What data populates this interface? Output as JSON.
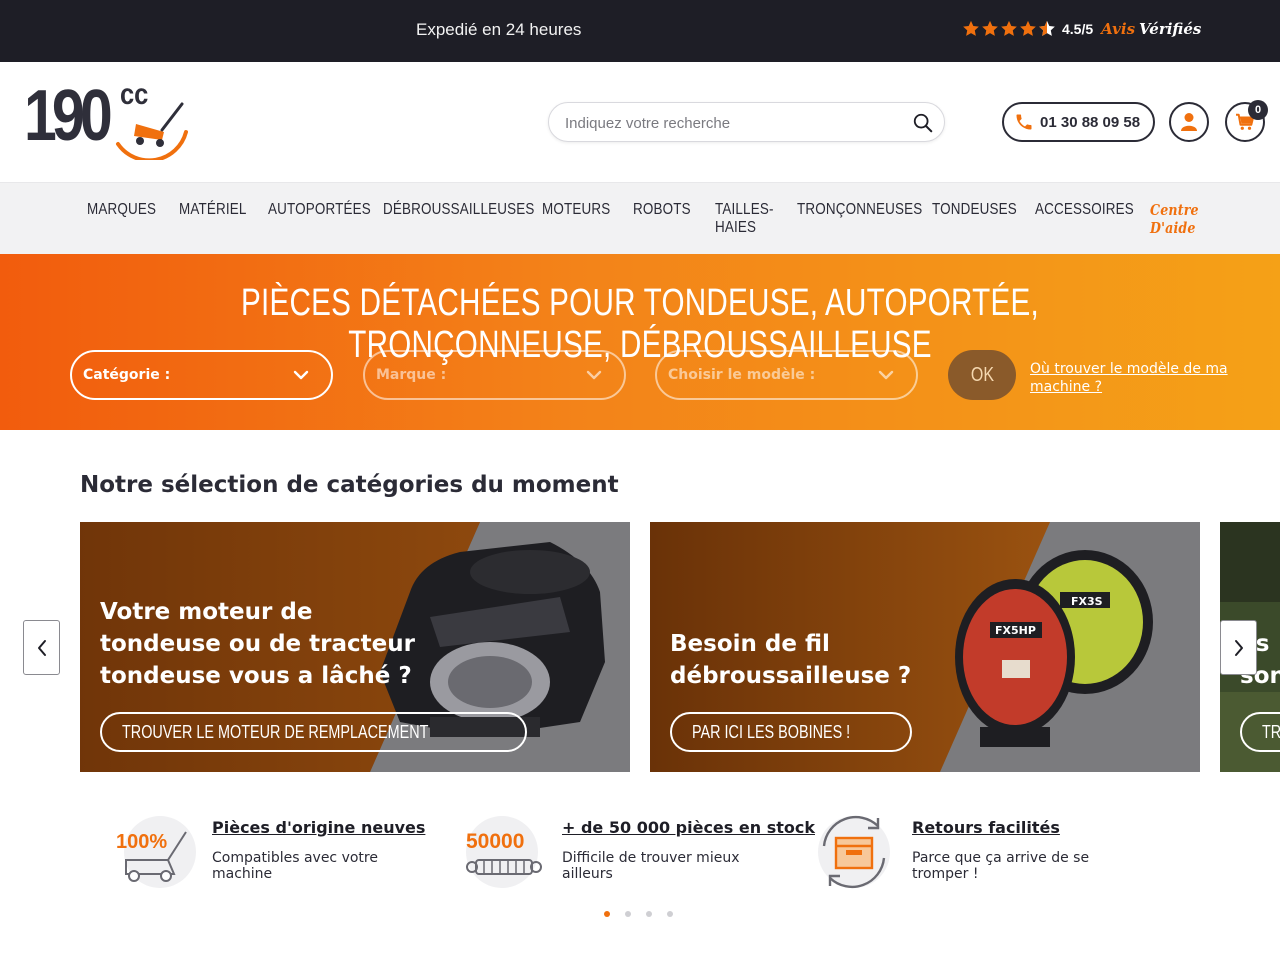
{
  "topbar": {
    "shipping": "Expedié en 24 heures",
    "rating_score": "4.5/5",
    "rating_avis": "Avis",
    "rating_verifies": "Vérifiés",
    "stars": 4.5,
    "star_color": "#f0700e"
  },
  "header": {
    "logo_number": "190",
    "logo_suffix": "cc",
    "search_placeholder": "Indiquez votre recherche",
    "phone": "01 30 88 09 58",
    "cart_count": "0"
  },
  "nav": {
    "items": [
      "Marques",
      "Matériel",
      "Autoportées",
      "Débroussailleuses",
      "Moteurs",
      "Robots",
      "Tailles-",
      "haies",
      "Tronçonneuses",
      "Tondeuses",
      "Accessoires"
    ],
    "help_line1": "Centre",
    "help_line2": "D'aide"
  },
  "banner": {
    "title": "PIÈCES DÉTACHÉES POUR TONDEUSE, AUTOPORTÉE, TRONÇONNEUSE, DÉBROUSSAILLEUSE",
    "select_category": "Catégorie :",
    "select_brand": "Marque :",
    "select_model": "Choisir le modèle :",
    "ok_label": "OK",
    "where_link": "Où trouver le modèle de ma machine ?",
    "colors": {
      "start": "#f25c0d",
      "end": "#f5a117"
    }
  },
  "selection": {
    "title": "Notre sélection de catégories du moment",
    "cards": [
      {
        "title": "Votre moteur de tondeuse ou de tracteur tondeuse vous a lâché ?",
        "button": "TROUVER LE MOTEUR DE REMPLACEMENT"
      },
      {
        "title": "Besoin de fil débroussailleuse ?",
        "button": "PAR ICI LES BOBINES !",
        "spool_label_1": "FX5HP",
        "spool_label_2": "FX3S"
      },
      {
        "title_partial": "os",
        "title_partial2": "son",
        "button_partial": "TR"
      }
    ]
  },
  "features": [
    {
      "title": "Pièces d'origine neuves",
      "desc": "Compatibles avec votre machine",
      "icon_text": "100%"
    },
    {
      "title": "+ de 50 000 pièces en stock",
      "desc": "Difficile de trouver mieux ailleurs",
      "icon_text": "50000"
    },
    {
      "title": "Retours facilités",
      "desc": "Parce que ça arrive de se tromper !"
    }
  ],
  "carousel": {
    "dot_count": 4,
    "active_dot": 1
  }
}
